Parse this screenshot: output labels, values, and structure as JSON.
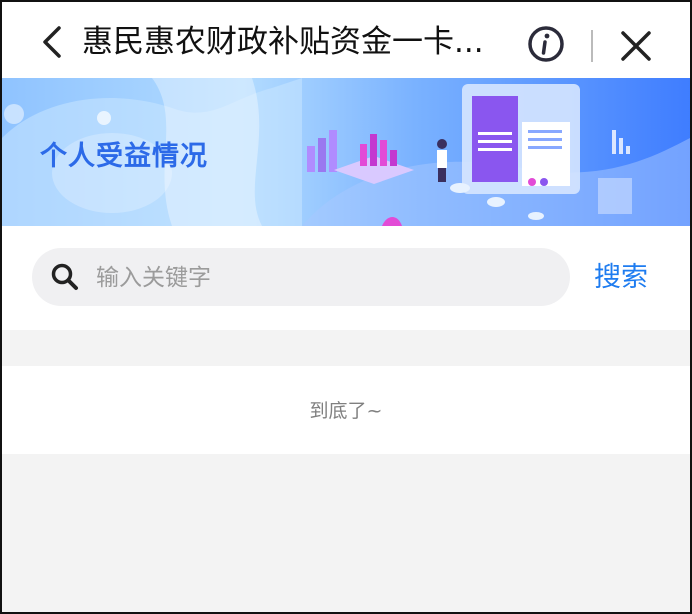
{
  "navbar": {
    "title": "惠民惠农财政补贴资金一卡...",
    "icons": {
      "back": "chevron-left-icon",
      "info": "info-icon",
      "close": "close-icon"
    }
  },
  "banner": {
    "title": "个人受益情况",
    "colors": {
      "title": "#2c6ae8",
      "accent": "#3f7dff"
    }
  },
  "search": {
    "placeholder": "输入关键字",
    "value": "",
    "button_label": "搜索",
    "icon": "search-icon"
  },
  "list": {
    "end_text": "到底了~"
  },
  "colors": {
    "link": "#1e7cf0",
    "background": "#f3f3f3"
  }
}
